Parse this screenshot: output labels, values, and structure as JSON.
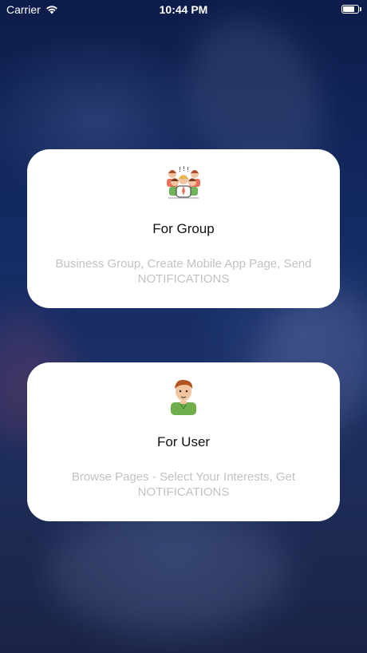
{
  "status_bar": {
    "carrier": "Carrier",
    "time": "10:44 PM",
    "battery_level": 0.85
  },
  "cards": [
    {
      "title": "For Group",
      "description": "Business Group, Create Mobile App Page, Send NOTIFICATIONS",
      "icon": "group-people-icon"
    },
    {
      "title": "For User",
      "description": "Browse Pages - Select Your Interests, Get NOTIFICATIONS",
      "icon": "user-person-icon"
    }
  ],
  "colors": {
    "background": "#132b63",
    "card": "#ffffff",
    "title": "#111111",
    "description": "#c2c2c2"
  }
}
